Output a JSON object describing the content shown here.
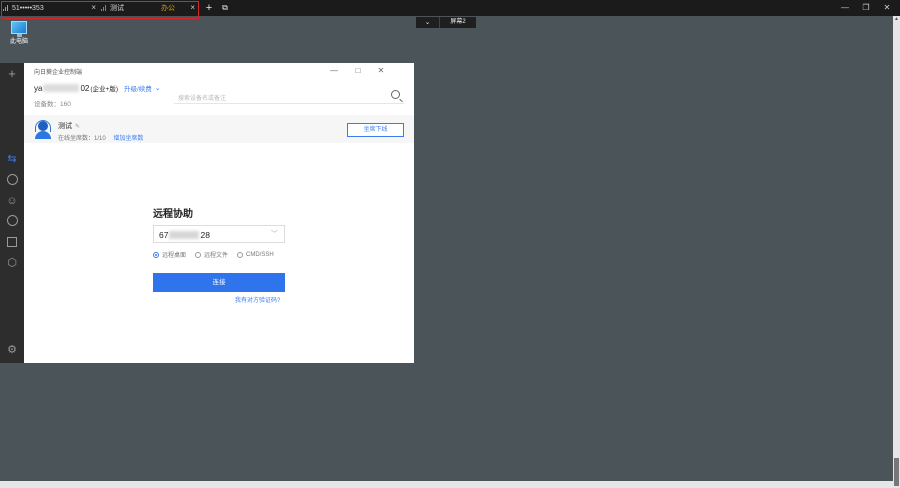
{
  "tabs": [
    {
      "label": "51•••••353",
      "close": "×"
    },
    {
      "label": "测试",
      "badge": "办公",
      "close": "×"
    }
  ],
  "toolbar": {
    "add": "+",
    "copy": "⧉"
  },
  "window_controls": {
    "minimize": "—",
    "restore": "❐",
    "close": "✕"
  },
  "screen_switch": {
    "arrow": "⌄",
    "label": "屏幕2"
  },
  "desktop": {
    "icon_label": "此电脑"
  },
  "sidebar": {
    "add": "+"
  },
  "app": {
    "title": "向日葵企业控制端",
    "account_prefix": "ya",
    "account_suffix": "02",
    "edition": "(企业+版)",
    "upgrade": "升级/续费",
    "device_count": "设备数：160",
    "search_placeholder": "搜索设备名或备注"
  },
  "status": {
    "name": "测试",
    "online_seats": "在线坐席数：1/10",
    "increase_seats": "增加坐席数",
    "offline_button": "坐席下线"
  },
  "remote": {
    "title": "远程协助",
    "id_prefix": "67",
    "id_suffix": "28",
    "options": [
      "远程桌面",
      "远程文件",
      "CMD/SSH"
    ],
    "selected": 0,
    "connect": "连接",
    "verify_link": "我有对方验证码?"
  }
}
